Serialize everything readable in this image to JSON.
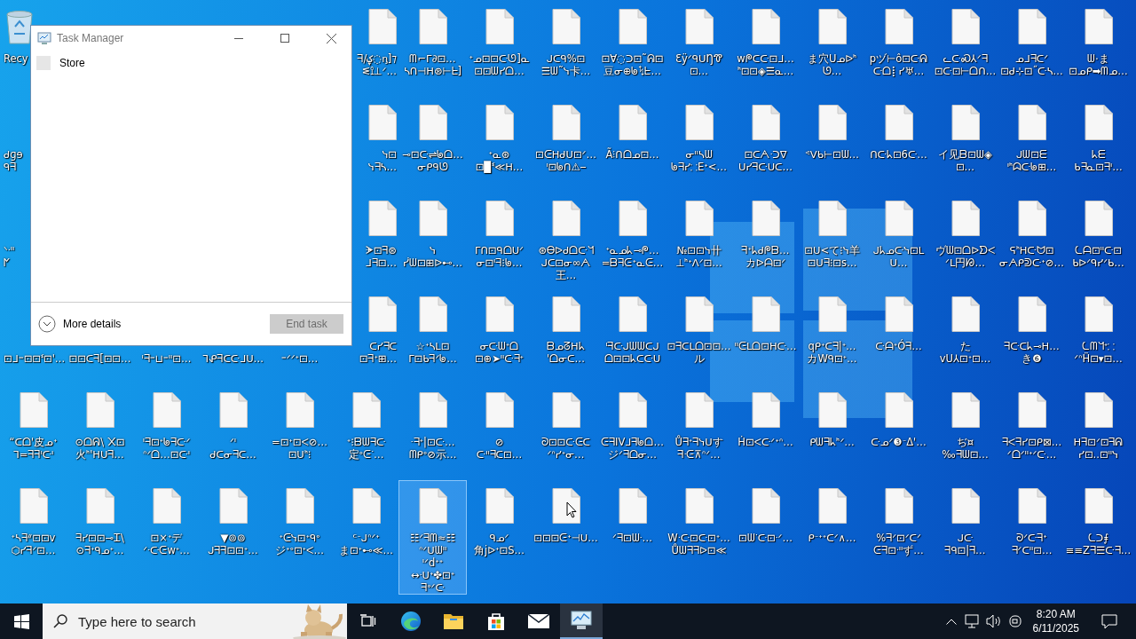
{
  "desktop": {
    "icons": [
      [
        {
          "kind": "recycle-bin",
          "label": "Recy",
          "selected": false
        },
        {
          "kind": "file",
          "label": "ᖷ/ؼ◌ᶇ]⁊\nᓬ⟟⊥ᐟ…",
          "selected": false
        },
        {
          "kind": "file",
          "label": "ᗰ⌐ᒥ∂⊡…\nᓴᑎ⊣ᕼ⊛⊢ᖶ]",
          "selected": false
        },
        {
          "kind": "file",
          "label": "ᐩᓄ⊡⊡ᑢᘎ]ᓇ\n⊡⊡ᗯᓯᗝ…",
          "selected": false
        },
        {
          "kind": "file",
          "label": "ᒍᑕᑫ%⊡\n☰ᗯ˜ᓭ卡…",
          "selected": false
        },
        {
          "kind": "file",
          "label": "⊡Ɐ◌ᑐ⊡˜ᕱ⊡\n豆ᓂ⊕ᖚᛪᖶ…",
          "selected": false
        },
        {
          "kind": "file",
          "label": "ƐÿᐟᑫᑌŊᏡ⊡…",
          "selected": false
        },
        {
          "kind": "file",
          "label": "wᖘᑕᑢ⊡ᒧ…\nᑋ⊡⊡◈☰ᓇ…",
          "selected": false
        },
        {
          "kind": "file",
          "label": "ま穴Uᓄᐅᑋᘎ…",
          "selected": false
        },
        {
          "kind": "file",
          "label": "pヅ⊢ô⊡ᑢᕱ\nᑢᗝ⡇ᓯ♅…",
          "selected": false
        },
        {
          "kind": "file",
          "label": "ᓚᑢᏍ⅄ᐟᖷ\n⊡ᑢ⊡⊢ᗝᑎ…",
          "selected": false
        },
        {
          "kind": "file",
          "label": "ᓄᒧᖷᑕᐟ\n⊡ᑯ⊹⊡˝ᑢᓴ…",
          "selected": false
        },
        {
          "kind": "file",
          "label": "ᗯ⋅ま\n⊡ᓄᑭ➡ᗰᓄ…",
          "selected": false
        }
      ],
      [
        {
          "kind": "label-only",
          "label": "ᑯɡɘ\nᑫᖷ",
          "selected": false
        },
        {
          "kind": "file",
          "label": "ᓭ⊡\nᓭᖷᓴ…",
          "selected": false
        },
        {
          "kind": "file",
          "label": "⊸⊡ᑢ⇌ᖚᗝ…\nᓂᑭᑫᘎ",
          "selected": false
        },
        {
          "kind": "file",
          "label": "ᐩᓇ⊛\n⊡▉ᓫ≪ᕼ…",
          "selected": false
        },
        {
          "kind": "file",
          "label": "⊡ᕮᕼᑯᑌ⊡ᐟ…\nᑊ⊡ᖚᑎ⚠⎯",
          "selected": false
        },
        {
          "kind": "file",
          "label": "Ã⫶ᑎᗝᓄ⊡…",
          "selected": false
        },
        {
          "kind": "file",
          "label": "ᓂᐦᓴᗯ\nᖚᖷᓯ⸬Eᐩ<…",
          "selected": false
        },
        {
          "kind": "file",
          "label": "⊡ᑕᗅᐧᑐᐁ\nᑌᓯᖷᑢᑌᑕ…",
          "selected": false
        },
        {
          "kind": "file",
          "label": "ᕝᐯᑲ⊢⊡ᗯ…",
          "selected": false
        },
        {
          "kind": "file",
          "label": "ᑎᑢᖾ⊡6ᑢ…",
          "selected": false
        },
        {
          "kind": "file",
          "label": "イ见ᗷ⊡ᗯ◈⊡…",
          "selected": false
        },
        {
          "kind": "file",
          "label": "ᒍᗯ⊡ᗴ\nᑊᑋᗣᑢᖚ⊞…",
          "selected": false
        },
        {
          "kind": "file",
          "label": "ᖾᗴ\nᑲᖷᓇ⊡ᖷᑊ…",
          "selected": false
        }
      ],
      [
        {
          "kind": "label-only",
          "label": "ᐠᐧᐦ\nᖼ",
          "selected": false
        },
        {
          "kind": "file",
          "label": "ᗚ⊡ᖷ⊛\nᒧᖷ⊡…",
          "selected": false
        },
        {
          "kind": "file",
          "label": "ᓭ\nᓰᗯ⊡⊞ᐅ⊷…",
          "selected": false
        },
        {
          "kind": "file",
          "label": "ᒥᑎ⊡ᑫᗝᑌᐟ\nᓂ⊡ᑊᖷ⁝ᖚ…",
          "selected": false
        },
        {
          "kind": "file",
          "label": "⊛Ꮎᐅᑯᗝᑢᖻ\nᒍᑕ⊡ᓂ∞ᗅ王…",
          "selected": false
        },
        {
          "kind": "file",
          "label": "ᐩᓇᓄᖾ⊸ᖘ…\n=ᗷᖷᕮᐩᓇᕮ…",
          "selected": false
        },
        {
          "kind": "file",
          "label": "№⊡⊡ᓭ卄\n⊥ᑋᐩᐱᐟ⊡…",
          "selected": false
        },
        {
          "kind": "file",
          "label": "ᖷᐩᖾᑯᖘᗷ…\nカᐅᗩ⊡ᐟ",
          "selected": false
        },
        {
          "kind": "file",
          "label": "⊡ᑌ<て⁝ᓭ羊\n⊡ᑌᖷ⁝⊡s…",
          "selected": false
        },
        {
          "kind": "file",
          "label": "ᒍᖾᓄᑢᓭ⊡ᒪᑌ…",
          "selected": false
        },
        {
          "kind": "file",
          "label": "ヴᗯ⊡ᗝᐅᗤᐸ\nᐟᒪ円ᘘ…",
          "selected": false
        },
        {
          "kind": "file",
          "label": "ᕋᑋᕼᑢᗢ⊡\nᓂᗅᑭᕲᑢᐩ⊘…",
          "selected": false
        },
        {
          "kind": "file",
          "label": "ᘇᗩ⊡ᐦᑢ⊡\nᑲᐅᐟᑫᓯᐟᑲ…",
          "selected": false
        }
      ],
      [
        {
          "kind": "label-only",
          "label": "⊡ᒧ⁼⊡⊡ᓫ⊡'…",
          "selected": false
        },
        {
          "kind": "label-only",
          "label": "⊡⊡ᑕᖷ[⊡⊡…",
          "selected": false
        },
        {
          "kind": "label-only",
          "label": "ᑊᖷ⁼⊔⁼ᐦ⊡…",
          "selected": false
        },
        {
          "kind": "label-only",
          "label": "ᒣᕵᖷᑕᑢᒧᑌ…",
          "selected": false
        },
        {
          "kind": "label-only",
          "label": "⁼ᐟᐟᐩ⊡…",
          "selected": false
        },
        {
          "kind": "file",
          "label": "ᑕᓯᖷᑕ\n⊡ᖷᐩ⊞…",
          "selected": false
        },
        {
          "kind": "file",
          "label": "☆ᐩᓴᒪ⊡\nᒥ⊡ᑲᖷᐟᖚ…",
          "selected": false
        },
        {
          "kind": "file",
          "label": "ᓂᑢᗯᐩᗝ\n⊡⊕➤ᐦᑢᖷᐩ",
          "selected": false
        },
        {
          "kind": "file",
          "label": "ᗷᓄᘔᕼᖾ\n'ᗝᓂᑕ…",
          "selected": false
        },
        {
          "kind": "file",
          "label": "ᑊᖷᑢᒍᗯᗯᑕᒍ\nᗝ⊡⊡ᖾᑕᑢᑌ",
          "selected": false
        },
        {
          "kind": "file",
          "label": "⊡ᖷᑕᒪᗝ⊡⊡…\nル",
          "selected": false
        },
        {
          "kind": "file",
          "label": "ᐦᕮᒪᗝ⊡ᕼᑢ…",
          "selected": false
        },
        {
          "kind": "file",
          "label": "qᑭᐩᑕᖷ|ᐩ…\nカWᑫ⊡ᐩ…",
          "selected": false
        },
        {
          "kind": "file",
          "label": "ᑢᗩᐩÓᖷ…",
          "selected": false
        },
        {
          "kind": "file",
          "label": "た\nvU⅄⊡ᐩ⊡…",
          "selected": false
        },
        {
          "kind": "file",
          "label": "ᖷᑢᑕᖾ⊸ᕼ…\nき❻",
          "selected": false
        },
        {
          "kind": "file",
          "label": "ᘇᗰᖻᐩ⸬\nᐟᐢḦ⊡▾⊡…",
          "selected": false
        }
      ],
      [
        {
          "kind": "file",
          "label": "“ᑕᗝ'皮ᓄᐩ\nᒣ=ᖷᖷᑊᑢᑊ",
          "selected": false
        },
        {
          "kind": "file",
          "label": "⊙ᗝᕱ\\ ᙭⊡\n火ᑋ'ᕼᑌᖷ…",
          "selected": false
        },
        {
          "kind": "file",
          "label": "ᑊᖷ⊡ᐩᖚᖷᑢᐟ\nᐢᐟᗝ…⊡ᑢᑊ",
          "selected": false
        },
        {
          "kind": "file",
          "label": "ᐟᑊ\nᑯᑕᓂᖷᑕ…",
          "selected": false
        },
        {
          "kind": "file",
          "label": "=⊡ᐩ⊡ᐸ⊘…\n⊡ᑌᑋ⁝",
          "selected": false
        },
        {
          "kind": "file",
          "label": "ᐩ⁝ᗷᗯᖷᑢ\n定ᐤᕮᐝ…",
          "selected": false
        },
        {
          "kind": "file",
          "label": "ᐧᖷᐩ|⊡ᑢ…\nᗰᑭᐤ⊘示…",
          "selected": false
        },
        {
          "kind": "file",
          "label": "⊘\nᑢᐦᖷᑕ⊡…",
          "selected": false
        },
        {
          "kind": "file",
          "label": "ᘐ⊡⊡ᑢᕮᑕ\nᐟᐢᓯᐩᓂ…",
          "selected": false
        },
        {
          "kind": "file",
          "label": "ᕮᖷIVᒧᖷᖚᗝ…\nジᐟᖷᗝᓂ…",
          "selected": false
        },
        {
          "kind": "file",
          "label": "Ůᖷᐩᖷᓭᑌす\nᖷᐧᕮ⊼ᐢᐟ…",
          "selected": false
        },
        {
          "kind": "file",
          "label": "Ḣ⊡ᐸᑢᐟᐩᐢ…",
          "selected": false
        },
        {
          "kind": "file",
          "label": "ᑭᗯᖷᖾᑋᐟ…",
          "selected": false
        },
        {
          "kind": "file",
          "label": "ᑢᓄᐟ❸ᐨΔ'…",
          "selected": false
        },
        {
          "kind": "file",
          "label": "ぢ¤\n‰ᖷᗯ⊡…",
          "selected": false
        },
        {
          "kind": "file",
          "label": "ᖷᐸᖷᓯ⊡ᑭ⊠…\nᐟᗝᐟᐦᐩᐟᑢ…",
          "selected": false
        },
        {
          "kind": "file",
          "label": "ᕼᖷ⊡ᐟ⊡ᖷᕱ\nᓯ⊡..⊡ᐦᓭ",
          "selected": false
        }
      ],
      [
        {
          "kind": "file",
          "label": "ᐩᓴᖷᐥ⊡⊡v\n⬡ᓯᖷᐟ⊡…",
          "selected": false
        },
        {
          "kind": "file",
          "label": "ᖷᓯ⊡⊡⊸Ꮖ\\\n⊙ᖷᐩᑫᓄᐩ…",
          "selected": false
        },
        {
          "kind": "file",
          "label": "⊡×ᐩデ\nᐟᐧᑢᕮwᐩ…",
          "selected": false
        },
        {
          "kind": "file",
          "label": "▼⊚⊚\nᒍᖷᖷ⊡⊡ᐩ…",
          "selected": false
        },
        {
          "kind": "file",
          "label": "ᐩᕮᓭ⊡ᐩᑫᐤ\nジᐩᐤ⊡ᐩᐸ…",
          "selected": false
        },
        {
          "kind": "file",
          "label": "ᑦᐨᒍᐢᐟᐩ\nま⊡ᐩ⊷≪…",
          "selected": false
        },
        {
          "kind": "file",
          "label": "☷ᐟᖷᗰ≈☷\nᐢᐟᑌᗯᐦ\nᑊᐟdᐩᐩ\n↔ᐧᑌᐩ✤⊡ᐩ\nᖷᐤᐟᑢ",
          "selected": true
        },
        {
          "kind": "file",
          "label": "ᑫᓄᐟ\n角jᐅᐩ⊡S…",
          "selected": false
        },
        {
          "kind": "file",
          "label": "⊡⊡⊡ᕮᐩ⊣ᑌ…",
          "selected": false
        },
        {
          "kind": "file",
          "label": "ᐟᖷ⊡ᗯᐧ…",
          "selected": false
        },
        {
          "kind": "file",
          "label": "Wᐧᑢ⊡ᑢ⊡ᐩ…\nŮᗯᖷᖷᐅ⊡≪",
          "selected": false
        },
        {
          "kind": "file",
          "label": "⊡ᗯᐝᑢ⊡ᐧᐟ…",
          "selected": false
        },
        {
          "kind": "file",
          "label": "ᑭᐨᐩᐩᑕᐟ∧…",
          "selected": false
        },
        {
          "kind": "file",
          "label": "%ᖷᐟ⊡ᐟᑕᐟ\nᕮᖷ⊡ᐧᐦず…",
          "selected": false
        },
        {
          "kind": "file",
          "label": "ᒍᑢ\nᖷᑫ⊡|ᖷ…",
          "selected": false
        },
        {
          "kind": "file",
          "label": "ᘐᐟᑢᖷᐩ\nᖷᐟᑕᐦ⊡…",
          "selected": false
        },
        {
          "kind": "file",
          "label": "ᘇᑐ⨎\n≡≡Zᖷ☰ᑢᖷ…",
          "selected": false
        }
      ]
    ]
  },
  "task_manager": {
    "title": "Task Manager",
    "apps": [
      {
        "name": "Store",
        "selected": false
      }
    ],
    "more_details": "More details",
    "end_task": {
      "label": "End task",
      "disabled": true
    }
  },
  "taskbar": {
    "search": {
      "placeholder": "Type here to search"
    },
    "apps": [
      {
        "kind": "task-view",
        "running": false
      },
      {
        "kind": "edge",
        "running": false
      },
      {
        "kind": "explorer",
        "running": false
      },
      {
        "kind": "store",
        "running": false
      },
      {
        "kind": "mail",
        "running": false
      },
      {
        "kind": "task-manager",
        "running": true
      }
    ],
    "time": "8:20 AM",
    "date": "6/11/2025"
  }
}
